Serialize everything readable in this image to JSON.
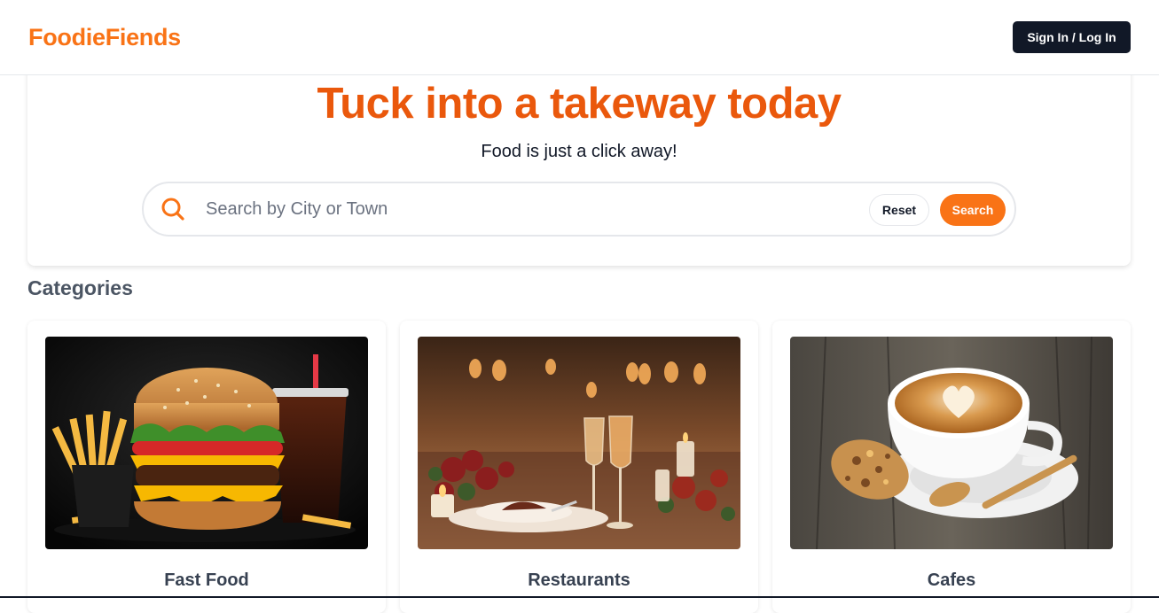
{
  "navbar": {
    "brand": "FoodieFiends",
    "signin_label": "Sign In / Log In"
  },
  "hero": {
    "title": "Tuck into a takeway today",
    "subtitle": "Food is just a click away!",
    "search": {
      "placeholder": "Search by City or Town",
      "value": "",
      "reset_label": "Reset",
      "search_label": "Search",
      "icon": "search-icon"
    }
  },
  "categories": {
    "heading": "Categories",
    "items": [
      {
        "label": "Fast Food",
        "image": "burger-fries-drink-photo"
      },
      {
        "label": "Restaurants",
        "image": "dining-table-candles-photo"
      },
      {
        "label": "Cafes",
        "image": "latte-cookie-photo"
      }
    ]
  },
  "colors": {
    "brand": "#f97316",
    "title": "#ea580c",
    "dark_button": "#111827"
  }
}
